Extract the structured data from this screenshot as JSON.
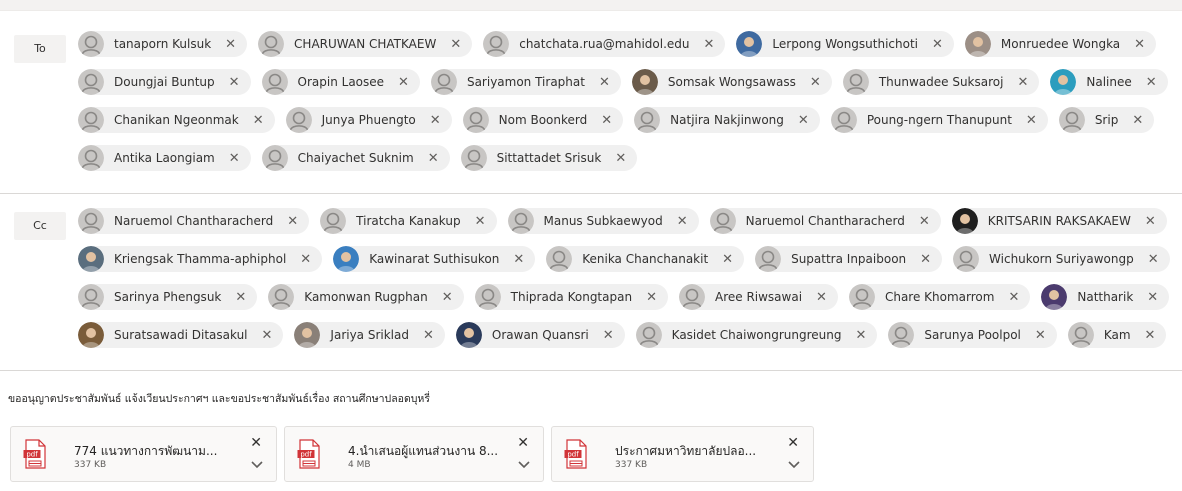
{
  "to": {
    "label": "To",
    "rows": [
      [
        {
          "name": "tanaporn Kulsuk",
          "avatar": "default"
        },
        {
          "name": "CHARUWAN CHATKAEW",
          "avatar": "default"
        },
        {
          "name": "chatchata.rua@mahidol.edu",
          "avatar": "default"
        },
        {
          "name": "Lerpong Wongsuthichoti",
          "avatar": "photo",
          "photo_color": "#3f6aa0"
        },
        {
          "name": "Monruedee Wongka",
          "avatar": "photo",
          "photo_color": "#9c8f86"
        }
      ],
      [
        {
          "name": "Doungjai Buntup",
          "avatar": "default"
        },
        {
          "name": "Orapin Laosee",
          "avatar": "default"
        },
        {
          "name": "Sariyamon Tiraphat",
          "avatar": "default"
        },
        {
          "name": "Somsak Wongsawass",
          "avatar": "photo",
          "photo_color": "#6b5b4a"
        },
        {
          "name": "Thunwadee Suksaroj",
          "avatar": "default"
        },
        {
          "name": "Nalinee",
          "avatar": "photo",
          "photo_color": "#2c9dbe"
        }
      ],
      [
        {
          "name": "Chanikan Ngeonmak",
          "avatar": "default"
        },
        {
          "name": "Junya Phuengto",
          "avatar": "default"
        },
        {
          "name": "Nom Boonkerd",
          "avatar": "default"
        },
        {
          "name": "Natjira Nakjinwong",
          "avatar": "default"
        },
        {
          "name": "Poung-ngern Thanupunt",
          "avatar": "default"
        },
        {
          "name": "Srip",
          "avatar": "default"
        }
      ],
      [
        {
          "name": "Antika Laongiam",
          "avatar": "default"
        },
        {
          "name": "Chaiyachet Suknim",
          "avatar": "default"
        },
        {
          "name": "Sittattadet Srisuk",
          "avatar": "default"
        }
      ]
    ]
  },
  "cc": {
    "label": "Cc",
    "rows": [
      [
        {
          "name": "Naruemol Chantharacherd",
          "avatar": "default"
        },
        {
          "name": "Tiratcha Kanakup",
          "avatar": "default"
        },
        {
          "name": "Manus Subkaewyod",
          "avatar": "default"
        },
        {
          "name": "Naruemol Chantharacherd",
          "avatar": "default"
        },
        {
          "name": "KRITSARIN RAKSAKAEW",
          "avatar": "photo",
          "photo_color": "#1f1f1f"
        }
      ],
      [
        {
          "name": "Kriengsak Thamma-aphiphol",
          "avatar": "photo",
          "photo_color": "#5a6e7e"
        },
        {
          "name": "Kawinarat Suthisukon",
          "avatar": "photo",
          "photo_color": "#3a7fc0"
        },
        {
          "name": "Kenika Chanchanakit",
          "avatar": "default"
        },
        {
          "name": "Supattra Inpaiboon",
          "avatar": "default"
        },
        {
          "name": "Wichukorn Suriyawongp",
          "avatar": "default"
        }
      ],
      [
        {
          "name": "Sarinya Phengsuk",
          "avatar": "default"
        },
        {
          "name": "Kamonwan Rugphan",
          "avatar": "default"
        },
        {
          "name": "Thiprada Kongtapan",
          "avatar": "default"
        },
        {
          "name": "Aree Riwsawai",
          "avatar": "default"
        },
        {
          "name": "Chare Khomarrom",
          "avatar": "default"
        },
        {
          "name": "Nattharik",
          "avatar": "photo",
          "photo_color": "#4b3b6e"
        }
      ],
      [
        {
          "name": "Suratsawadi Ditasakul",
          "avatar": "photo",
          "photo_color": "#7a5c3a"
        },
        {
          "name": "Jariya Sriklad",
          "avatar": "photo",
          "photo_color": "#8a8078"
        },
        {
          "name": "Orawan Quansri",
          "avatar": "photo",
          "photo_color": "#2a3a5a"
        },
        {
          "name": "Kasidet Chaiwongrungreung",
          "avatar": "default"
        },
        {
          "name": "Sarunya Poolpol",
          "avatar": "default"
        },
        {
          "name": "Kam",
          "avatar": "default"
        }
      ]
    ]
  },
  "subject": "ขออนุญาตประชาสัมพันธ์ แจ้งเวียนประกาศฯ และขอประชาสัมพันธ์เรื่อง สถานศึกษาปลอดบุหรี่",
  "attachments": [
    {
      "name": "774 แนวทางการพัฒนาม...",
      "size": "337 KB",
      "type": "pdf"
    },
    {
      "name": "4.นำเสนอผู้แทนส่วนงาน 8...",
      "size": "4 MB",
      "type": "pdf"
    },
    {
      "name": "ประกาศมหาวิทยาลัยปลอ...",
      "size": "337 KB",
      "type": "pdf"
    }
  ],
  "colors": {
    "chip_bg": "#f0f0f0",
    "avatar_default_bg": "#c8c6c4",
    "avatar_default_fg": "#8a8886",
    "pdf_red": "#d13438"
  }
}
